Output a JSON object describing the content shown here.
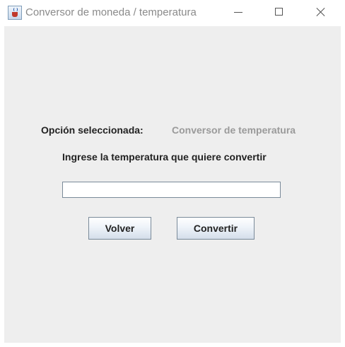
{
  "window": {
    "title": "Conversor de moneda / temperatura",
    "app_icon": "java-coffee-cup-icon",
    "controls": {
      "minimize": "minimize-icon",
      "maximize": "maximize-icon",
      "close": "close-icon"
    }
  },
  "form": {
    "option_label": "Opción seleccionada:",
    "option_value": "Conversor de temperatura",
    "instruction": "Ingrese la temperatura que quiere convertir",
    "temperature_input": {
      "value": "",
      "placeholder": ""
    },
    "back_button_label": "Volver",
    "convert_button_label": "Convertir"
  }
}
